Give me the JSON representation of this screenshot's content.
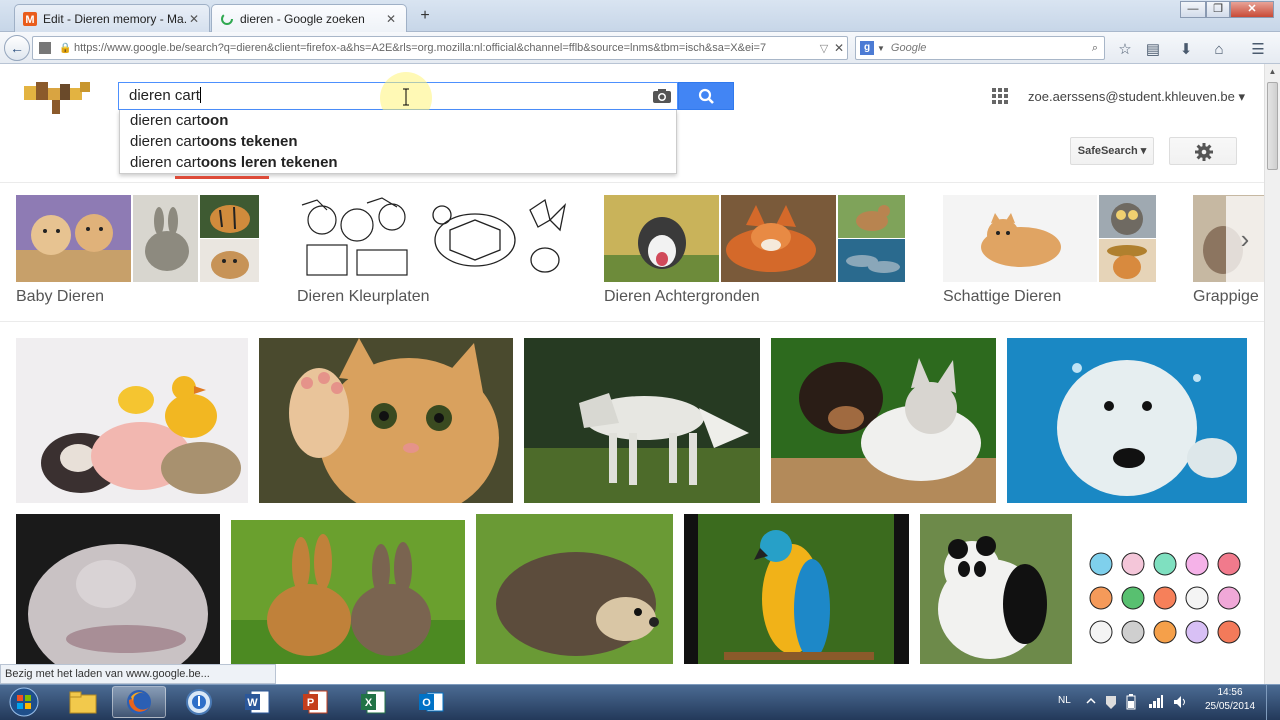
{
  "browser": {
    "tabs": [
      {
        "label": "Edit - Dieren memory - Ma...",
        "close": "✕"
      },
      {
        "label": "dieren - Google zoeken",
        "close": "✕"
      }
    ],
    "new_tab": "+",
    "window_controls": {
      "minimize": "—",
      "maximize": "❐",
      "close": "✕"
    },
    "back": "←",
    "url": "https://www.google.be/search?q=dieren&client=firefox-a&hs=A2E&rls=org.mozilla:nl:official&channel=fflb&source=lnms&tbm=isch&sa=X&ei=7",
    "url_dropdown": "▽",
    "url_clear": "✕",
    "search_engine_letter": "g",
    "search_placeholder": "Google",
    "status_text": "Bezig met het laden van www.google.be..."
  },
  "google": {
    "query": "dieren cart",
    "suggestions": [
      {
        "prefix": "dieren cart",
        "completion": "oon"
      },
      {
        "prefix": "dieren cart",
        "completion": "oons tekenen"
      },
      {
        "prefix": "dieren cart",
        "completion": "oons leren tekenen"
      }
    ],
    "account": "zoe.aerssens@student.khleuven.be",
    "account_caret": "▾",
    "safesearch_label": "SafeSearch ▾",
    "related": [
      {
        "label": "Baby Dieren"
      },
      {
        "label": "Dieren Kleurplaten"
      },
      {
        "label": "Dieren Achtergronden"
      },
      {
        "label": "Schattige Dieren"
      },
      {
        "label": "Grappige"
      }
    ],
    "related_next": "›"
  },
  "taskbar": {
    "language": "NL",
    "time": "14:56",
    "date": "25/05/2014"
  },
  "colors": {
    "google_blue": "#4285f4",
    "active_tab_underline": "#dd4b39",
    "taskbar": "#2d4669"
  }
}
